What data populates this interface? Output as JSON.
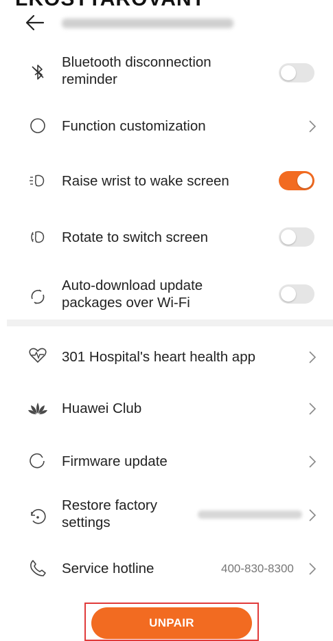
{
  "page": {
    "top_partial_text": "LKOSTTAROVANT",
    "accent_color": "#f26b21"
  },
  "header": {
    "back_icon": "arrow-left-icon"
  },
  "settings": {
    "bluetooth_reminder": {
      "label_line1": "Bluetooth disconnection",
      "label_line2": "reminder",
      "toggle_on": false
    },
    "function_customization": {
      "label": "Function customization"
    },
    "raise_wrist": {
      "label": "Raise wrist to wake screen",
      "toggle_on": true
    },
    "rotate_switch": {
      "label": "Rotate to switch screen",
      "toggle_on": false
    },
    "auto_download": {
      "label_line1": "Auto-download update",
      "label_line2": "packages over Wi-Fi",
      "toggle_on": false
    },
    "heart_health": {
      "label": "301 Hospital's heart health app"
    },
    "huawei_club": {
      "label": "Huawei Club"
    },
    "firmware_update": {
      "label": "Firmware update"
    },
    "restore_factory": {
      "label_line1": "Restore factory",
      "label_line2": "settings"
    },
    "service_hotline": {
      "label": "Service hotline",
      "value": "400-830-8300"
    }
  },
  "unpair": {
    "label": "UNPAIR"
  }
}
